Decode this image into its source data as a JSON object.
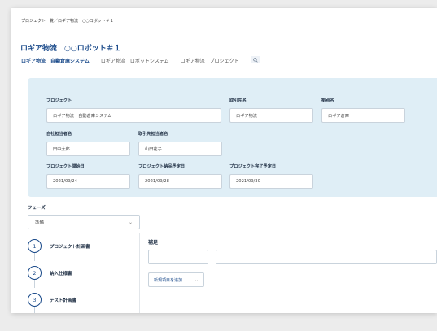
{
  "breadcrumb": "プロジェクト一覧／ロギア物流　○○ロボット＃１",
  "page_title": "ロギア物流　○○ロボット＃１",
  "tabs": [
    {
      "label": "ロギア物流　自動倉庫システム"
    },
    {
      "label": "ロギア物流　ロボットシステム"
    },
    {
      "label": "ロギア物流　プロジェクト"
    }
  ],
  "fields": {
    "project": {
      "label": "プロジェクト",
      "value": "ロギア物流　自動倉庫システム"
    },
    "client": {
      "label": "取引先名",
      "value": "ロギア物流"
    },
    "site": {
      "label": "拠点名",
      "value": "ロギア倉庫"
    },
    "own_staff": {
      "label": "自社担当者名",
      "value": "田中太郎"
    },
    "client_staff": {
      "label": "取引先担当者名",
      "value": "山田花子"
    },
    "start_date": {
      "label": "プロジェクト開始日",
      "value": "2021/09/24"
    },
    "delivery_date": {
      "label": "プロジェクト納品予定日",
      "value": "2021/09/28"
    },
    "end_date": {
      "label": "プロジェクト完了予定日",
      "value": "2021/09/30"
    }
  },
  "phase": {
    "label": "フェーズ",
    "selected": "準備"
  },
  "steps": [
    {
      "number": "1",
      "label": "プロジェクト計画書"
    },
    {
      "number": "2",
      "label": "納入仕様書"
    },
    {
      "number": "3",
      "label": "テスト計画書"
    }
  ],
  "supplement": {
    "label": "補足",
    "add_item": "新規項目を追加"
  }
}
